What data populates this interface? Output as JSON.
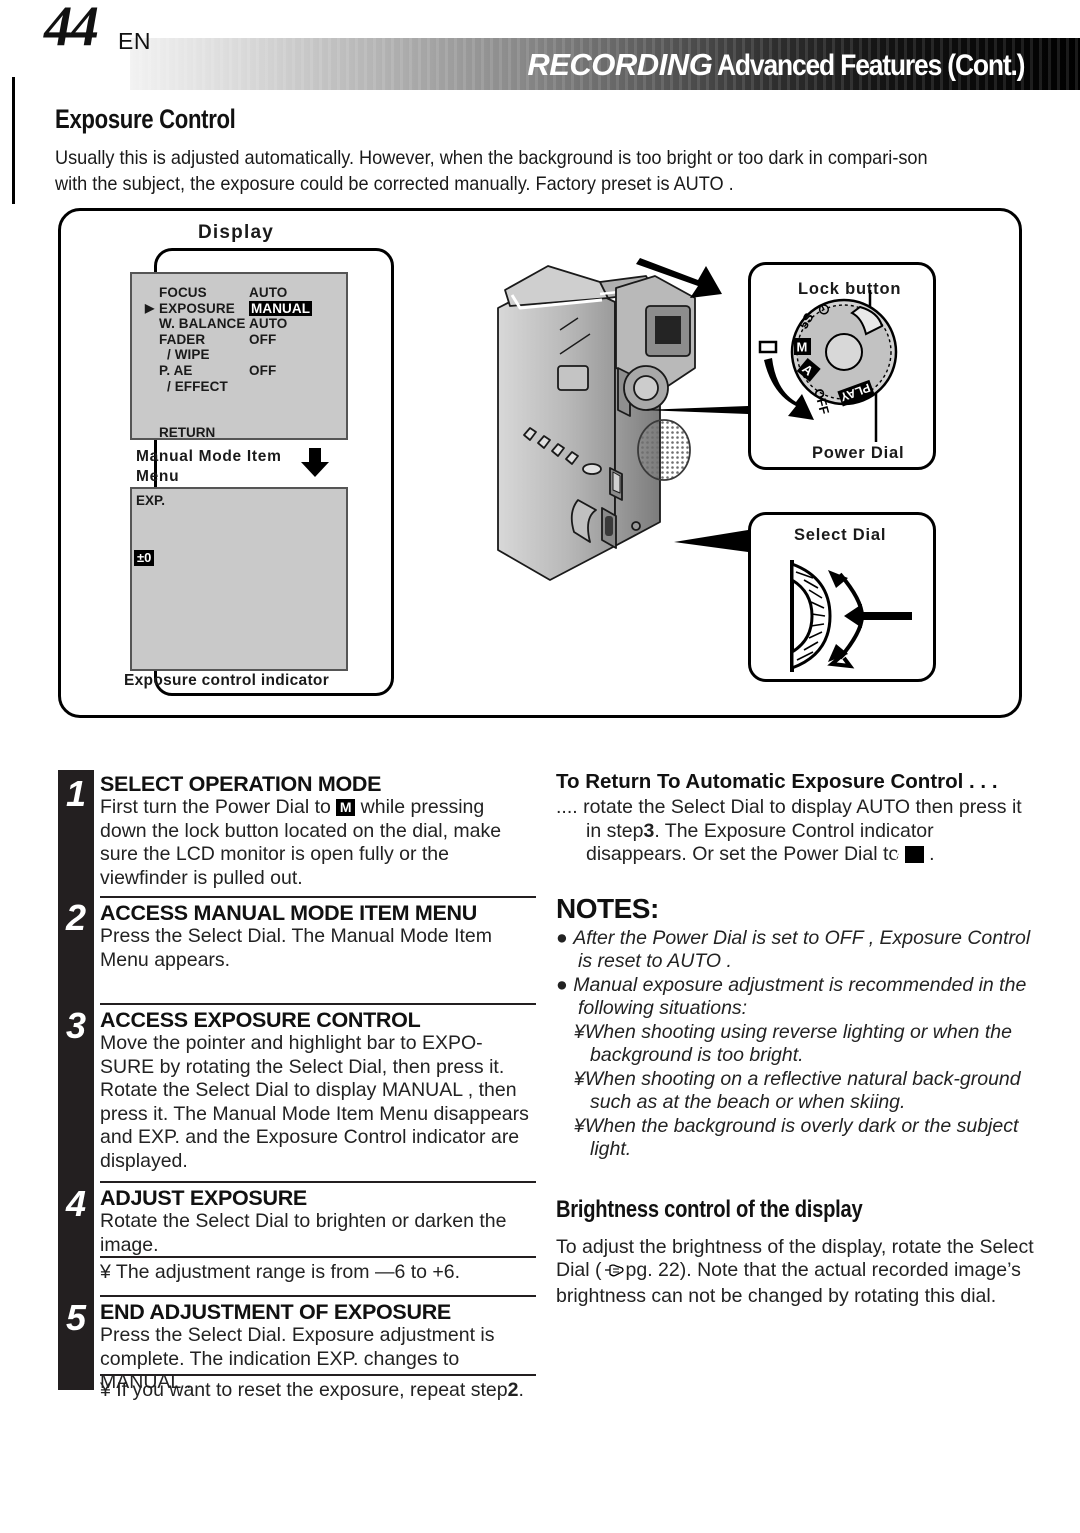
{
  "header": {
    "page_number": "44",
    "language": "EN",
    "title_primary": "RECORDING",
    "title_secondary": "Advanced Features (Cont.)"
  },
  "section": {
    "heading": "Exposure Control",
    "intro": "Usually this is adjusted automatically. However, when the background is too bright or too dark in compari-son with the subject, the exposure could be corrected manually. Factory preset is  AUTO ."
  },
  "figure": {
    "display_label": "Display",
    "manual_mode_item_label": "Manual Mode Item",
    "manual_mode_menu_label": "Menu",
    "exposure_indicator_label": "Exposure control indicator",
    "lcd_menu": {
      "rows": [
        {
          "pointer": "",
          "label": "FOCUS",
          "value": "AUTO",
          "highlight": false,
          "sub": false
        },
        {
          "pointer": "▶",
          "label": "EXPOSURE",
          "value": "MANUAL",
          "highlight": true,
          "sub": false
        },
        {
          "pointer": "",
          "label": "W. BALANCE",
          "value": "AUTO",
          "highlight": false,
          "sub": false
        },
        {
          "pointer": "",
          "label": "FADER",
          "value": "OFF",
          "highlight": false,
          "sub": false
        },
        {
          "pointer": "",
          "label": "/ WIPE",
          "value": "",
          "highlight": false,
          "sub": true
        },
        {
          "pointer": "",
          "label": "P. AE",
          "value": "OFF",
          "highlight": false,
          "sub": false
        },
        {
          "pointer": "",
          "label": "/ EFFECT",
          "value": "",
          "highlight": false,
          "sub": true
        }
      ],
      "return_label": "RETURN"
    },
    "lcd_exp": {
      "title": "EXP.",
      "value_badge": "±0"
    },
    "power_dial": {
      "lock_button_label": "Lock button",
      "caption": "Power Dial",
      "positions": [
        "5S",
        "⏻",
        "M",
        "A",
        "OFF",
        "PLAY"
      ]
    },
    "select_dial": {
      "caption": "Select Dial"
    }
  },
  "steps": [
    {
      "num": "1",
      "head": "SELECT OPERATION MODE",
      "body_pre": "First turn the Power Dial to ",
      "glyph": "M",
      "body_post": " while pressing down the lock button located on the dial, make sure the LCD monitor is open fully or the viewfinder is pulled out."
    },
    {
      "num": "2",
      "head": "ACCESS MANUAL MODE ITEM MENU",
      "body": "Press the Select Dial. The Manual Mode Item Menu appears."
    },
    {
      "num": "3",
      "head": "ACCESS EXPOSURE CONTROL",
      "body": "Move the pointer and highlight bar to  EXPO-SURE  by rotating the Select Dial, then press it. Rotate the Select Dial to display  MANUAL , then press it. The Manual Mode Item Menu disappears and  EXP.  and the Exposure Control indicator are displayed."
    },
    {
      "num": "4",
      "head": "ADJUST EXPOSURE",
      "body": "Rotate the Select Dial to brighten or darken the image.",
      "note": "¥ The adjustment range is from —6 to +6."
    },
    {
      "num": "5",
      "head": "END ADJUSTMENT OF EXPOSURE",
      "body": "Press the Select Dial. Exposure adjustment is complete. The indication  EXP.  changes to  MANUAL .",
      "note_pre": "¥ If you want to reset the exposure, repeat step",
      "note_step": "2",
      "note_post": "."
    }
  ],
  "right_column": {
    "return_auto": {
      "head": "To Return To Automatic Exposure Control . . .",
      "body_pre": ".... rotate the Select Dial to display  AUTO  then press it in step",
      "step_ref": "3",
      "body_mid": ". The Exposure Control indicator disappears. Or set the Power Dial to ",
      "glyph": "A",
      "body_post": " ."
    },
    "notes": {
      "heading": "NOTES:",
      "items": [
        "After the Power Dial is set to  OFF , Exposure Control is reset to  AUTO .",
        "Manual exposure adjustment is recommended in the following situations:"
      ],
      "subitems": [
        "¥When shooting using reverse lighting or when the background is too bright.",
        "¥When shooting on a reflective natural back-ground such as at the beach or when skiing.",
        "¥When the background is overly dark or the subject light."
      ]
    },
    "brightness": {
      "heading": "Brightness control of the display",
      "body_pre": "To adjust the brightness of the display, rotate the Select Dial (",
      "page_ref": "pg. 22",
      "body_post": "). Note that the actual recorded image’s brightness can not be changed by rotating this dial."
    }
  }
}
